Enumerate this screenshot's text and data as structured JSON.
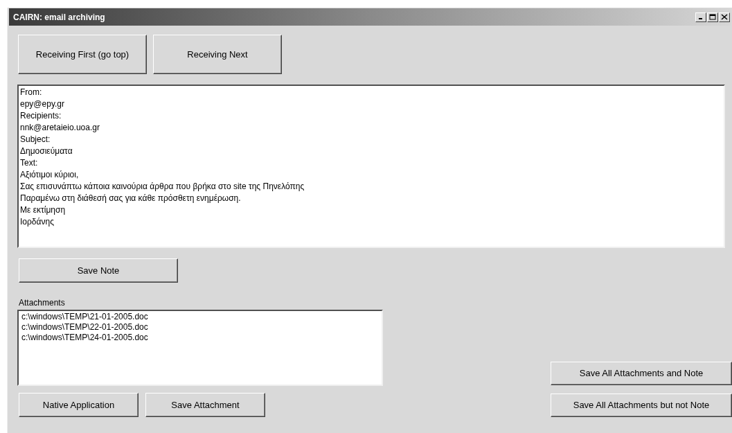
{
  "window": {
    "title": "CAIRN: email archiving"
  },
  "top_buttons": [
    "Receiving First (go top)",
    "Receiving Next"
  ],
  "message_lines": [
    "From:",
    "epy@epy.gr",
    "Recipients:",
    "nnk@aretaieio.uoa.gr",
    "Subject:",
    "Δημοσιεύματα",
    "Text:",
    "Αξιότιμοι κύριοι,",
    "Σας επισυνάπτω κάποια καινούρια άρθρα που βρήκα στο site της Πηνελόπης",
    "Παραμένω στη διάθεσή σας για κάθε πρόσθετη ενημέρωση.",
    "Με εκτίμηση",
    "Ιορδάνης"
  ],
  "save_note_button": "Save Note",
  "attachments": {
    "label": "Attachments",
    "items": [
      "c:\\windows\\TEMP\\21-01-2005.doc",
      "c:\\windows\\TEMP\\22-01-2005.doc",
      "c:\\windows\\TEMP\\24-01-2005.doc"
    ]
  },
  "attachment_buttons": [
    "Native Application",
    "Save Attachment"
  ],
  "save_all_buttons": [
    "Save All Attachments and Note",
    "Save All Attachments but not Note"
  ]
}
